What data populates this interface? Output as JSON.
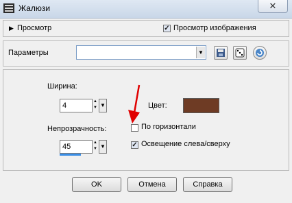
{
  "window": {
    "title": "Жалюзи",
    "close_glyph": "✕"
  },
  "preview": {
    "label": "Просмотр",
    "expander_glyph": "▶",
    "preview_image_label": "Просмотр изображения",
    "preview_image_checked": true
  },
  "params": {
    "label": "Параметры",
    "preset_value": "",
    "save_icon": "floppy-disk-icon",
    "random_icon": "dice-icon",
    "reset_icon": "reset-arrow-icon"
  },
  "settings": {
    "width_label": "Ширина:",
    "width_value": "4",
    "color_label": "Цвет:",
    "color_value": "#6e3b24",
    "opacity_label": "Непрозрачность:",
    "opacity_value": "45",
    "horizontal_label": "По горизонтали",
    "horizontal_checked": false,
    "light_label": "Освещение слева/сверху",
    "light_checked": true
  },
  "buttons": {
    "ok": "OK",
    "cancel": "Отмена",
    "help": "Справка"
  }
}
